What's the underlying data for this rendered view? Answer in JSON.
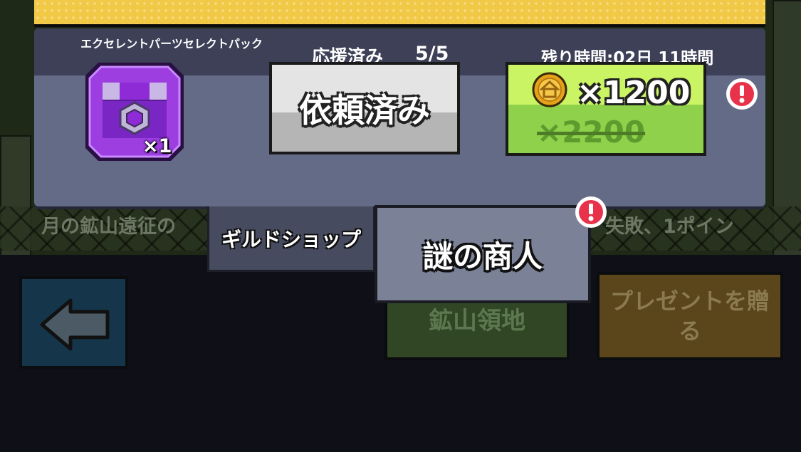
{
  "background": {
    "ticker_left": "月の鉱山遠征の",
    "ticker_right": "失敗、1ポイン"
  },
  "panel": {
    "item_name": "エクセレントパーツセレクトパック",
    "support_label": "応援済み",
    "support_count": "5/5",
    "time_remaining": "残り時間:02日 11時間",
    "item_quantity": "×1",
    "requested_label": "依頼済み",
    "coin_icon": "coin-icon",
    "price": "×1200",
    "original_price": "×2200"
  },
  "tabs": {
    "guild_shop": "ギルドショップ",
    "mystery_merchant": "謎の商人"
  },
  "bottom": {
    "back_icon": "left-arrow-icon",
    "mine_territory": "鉱山領地",
    "send_gift": "プレゼントを贈る"
  },
  "colors": {
    "banner": "#f2c947",
    "panel": "#646b86",
    "panel_header": "#3d4057",
    "buy_button": "#8fd14a",
    "alert": "#e8324a",
    "item_purple": "#9c3ee0"
  }
}
